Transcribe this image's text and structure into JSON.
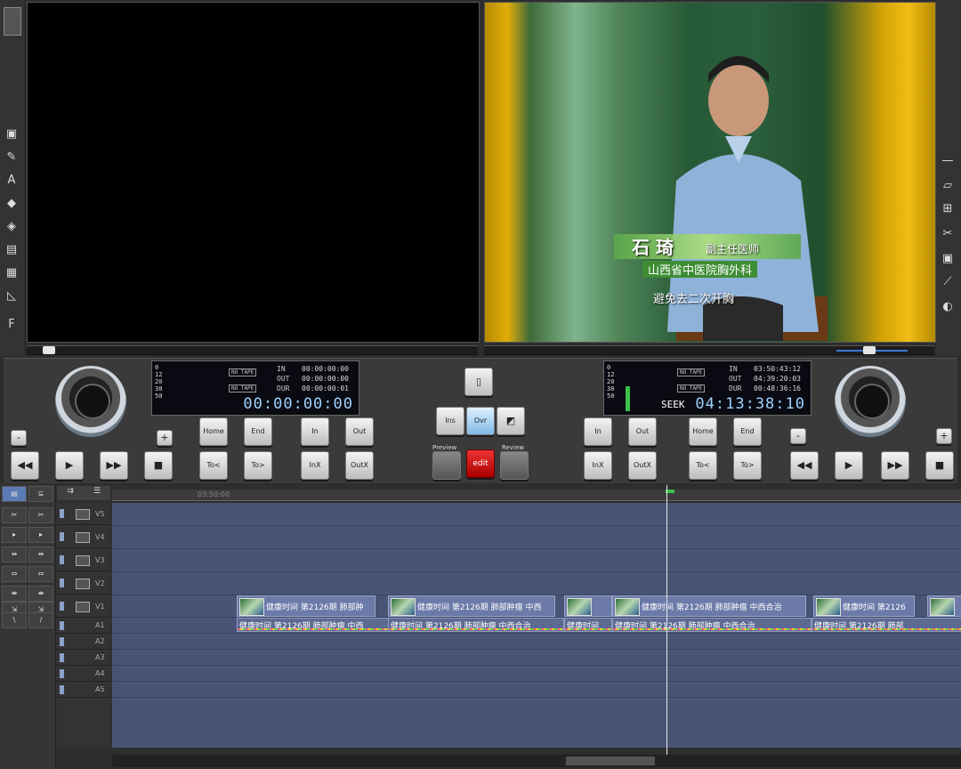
{
  "source_monitor": {
    "in_label": "IN",
    "out_label": "OUT",
    "dur_label": "DUR",
    "in": "00:00:00:00",
    "out": "00:00:00:00",
    "dur": "00:00:00:01",
    "timecode": "00:00:00:00",
    "scale": [
      "0",
      "12",
      "20",
      "30",
      "50"
    ],
    "tape1": "NO TAPE",
    "tape2": "NO TAPE"
  },
  "record_monitor": {
    "in_label": "IN",
    "out_label": "OUT",
    "dur_label": "DUR",
    "in": "03:50:43:12",
    "out": "04:39:20:03",
    "dur": "00:48:36:16",
    "timecode": "04:13:38:10",
    "mode": "SEEK",
    "scale": [
      "0",
      "12",
      "20",
      "30",
      "50"
    ],
    "tape1": "NO TAPE",
    "tape2": "NO TAPE",
    "lower_third": {
      "name": "石 琦",
      "title": "副主任医师",
      "org": "山西省中医院胸外科",
      "subtitle": "避免去二次开胸"
    }
  },
  "transport_left": {
    "home": "Home",
    "end": "End",
    "in": "In",
    "out": "Out",
    "to_prev": "To<",
    "to_next": "To>",
    "inx": "InX",
    "outx": "OutX",
    "minus": "-",
    "plus": "+"
  },
  "transport_right": {
    "in": "In",
    "out": "Out",
    "home": "Home",
    "end": "End",
    "inx": "InX",
    "outx": "OutX",
    "to_prev": "To<",
    "to_next": "To>",
    "minus": "-",
    "plus": "+"
  },
  "center_controls": {
    "ins": "Ins",
    "ovr": "Ovr",
    "preview": "Preview",
    "review": "Review",
    "edit": "edit"
  },
  "timeline": {
    "ruler": [
      "03:50:00"
    ],
    "tracks": [
      {
        "name": "V5"
      },
      {
        "name": "V4"
      },
      {
        "name": "V3"
      },
      {
        "name": "V2"
      },
      {
        "name": "V1"
      },
      {
        "name": "A1"
      },
      {
        "name": "A2"
      },
      {
        "name": "A3"
      },
      {
        "name": "A4"
      },
      {
        "name": "A5"
      }
    ],
    "video_clips": [
      {
        "label": "健康时间  第2126期  肺部肿"
      },
      {
        "label": "健康时间  第2126期  肺部肿瘤  中西"
      },
      {
        "label": ""
      },
      {
        "label": "健康时间  第2126期  肺部肿瘤  中西合治"
      },
      {
        "label": "健康时间  第2126"
      },
      {
        "label": ""
      }
    ],
    "audio_clips": [
      {
        "label": "健康时间  第2126期  肺部肿瘤  中西"
      },
      {
        "label": "健康时间  第2126期  肺部肿瘤  中西合治"
      },
      {
        "label": "健康时间"
      },
      {
        "label": "健康时间  第2126期  肺部肿瘤  中西合治"
      },
      {
        "label": "健康时间  第2126期  肺部"
      }
    ]
  }
}
